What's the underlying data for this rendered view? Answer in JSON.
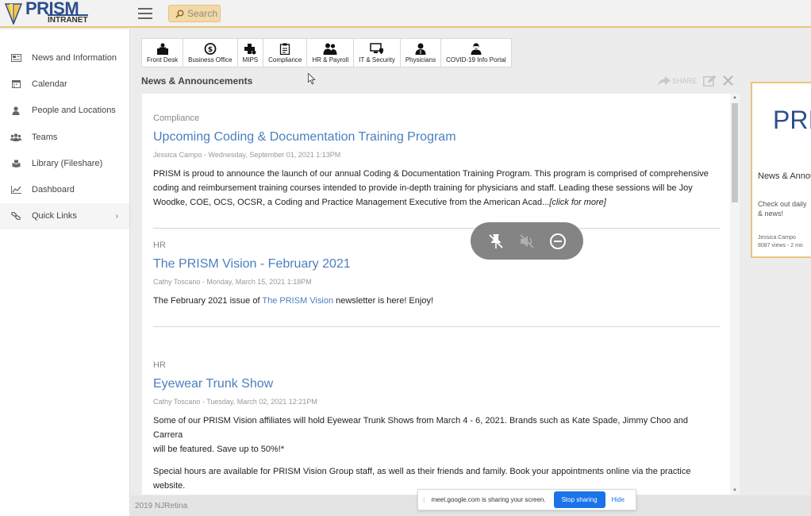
{
  "header": {
    "logo_text": "PRISM",
    "logo_sub": "INTRANET",
    "search_label": "Search",
    "menu_icon": "hamburger-icon",
    "search_icon": "magnifier-icon"
  },
  "sidebar": {
    "items": [
      {
        "label": "News and Information",
        "icon": "newspaper-icon"
      },
      {
        "label": "Calendar",
        "icon": "calendar-icon"
      },
      {
        "label": "People and Locations",
        "icon": "person-icon"
      },
      {
        "label": "Teams",
        "icon": "group-icon"
      },
      {
        "label": "Library (Fileshare)",
        "icon": "library-icon"
      },
      {
        "label": "Dashboard",
        "icon": "line-chart-icon"
      },
      {
        "label": "Quick Links",
        "icon": "link-icon"
      }
    ],
    "chevron": "›"
  },
  "tiles": [
    {
      "label": "Front Desk",
      "icon": "front-desk-icon"
    },
    {
      "label": "Business Office",
      "icon": "dollar-icon"
    },
    {
      "label": "MIPS",
      "icon": "medical-plus-icon"
    },
    {
      "label": "Compliance",
      "icon": "clipboard-icon"
    },
    {
      "label": "HR & Payroll",
      "icon": "people-icon"
    },
    {
      "label": "IT & Security",
      "icon": "computer-shield-icon"
    },
    {
      "label": "Physicians",
      "icon": "doctor-icon"
    },
    {
      "label": "COVID-19 Info Portal",
      "icon": "masked-person-icon"
    }
  ],
  "section": {
    "title": "News & Announcements",
    "share_label": "SHARE"
  },
  "articles": [
    {
      "category": "Compliance",
      "title": "Upcoming Coding & Documentation Training Program",
      "byline": "Jessica Campo - Wednesday, September 01, 2021 1:13PM",
      "line1": "PRISM is proud to announce the launch of our annual Coding & Documentation Training Program. This program is comprised of comprehensive",
      "line2": "coding and reimbursement training courses intended to provide in-depth training for physicians and staff. Leading these sessions will be Joy",
      "line3": "Woodke, COE, OCS, OCSR, a Coding and Practice Management Executive from the American Acad...",
      "more": "[click for more]"
    },
    {
      "category": "HR",
      "title": "The PRISM Vision - February 2021",
      "byline": "Cathy Toscano - Monday, March 15, 2021 1:18PM",
      "pre": "The February 2021 issue of ",
      "link": "The PRISM Vision",
      "post": " newsletter is here! Enjoy!"
    },
    {
      "category": "HR",
      "title": "Eyewear Trunk Show",
      "byline": "Cathy Toscano - Tuesday, March 02, 2021 12:21PM",
      "p1_line1": "Some of our PRISM Vision affiliates will hold Eyewear Trunk Shows from March 4 - 6, 2021. Brands such as Kate Spade, Jimmy Choo and Carrera",
      "p1_line2": "will be featured. Save up to 50%!*",
      "p2_line1": "Special hours are available for PRISM Vision Group staff, as well as their friends and family. Book your appointments online via the practice",
      "p2_line2": "website."
    }
  ],
  "card": {
    "logo": "PRI",
    "title": "News & Annou",
    "text1": "Check out daily",
    "text2": "& news!",
    "author": "Jessica Campo",
    "stats": "8087 views - 2 mo"
  },
  "footer": {
    "text": "2019 NJRetina"
  },
  "sharebar": {
    "message": "meet.google.com is sharing your screen.",
    "stop_label": "Stop sharing",
    "hide_label": "Hide"
  },
  "pill": {
    "buttons": [
      "pin-off-icon",
      "mute-icon",
      "minus-circle-icon"
    ]
  },
  "colors": {
    "accent": "#e8c77a",
    "brand": "#2d4e8c",
    "link": "#4a7fbf",
    "google_blue": "#1a73e8"
  }
}
